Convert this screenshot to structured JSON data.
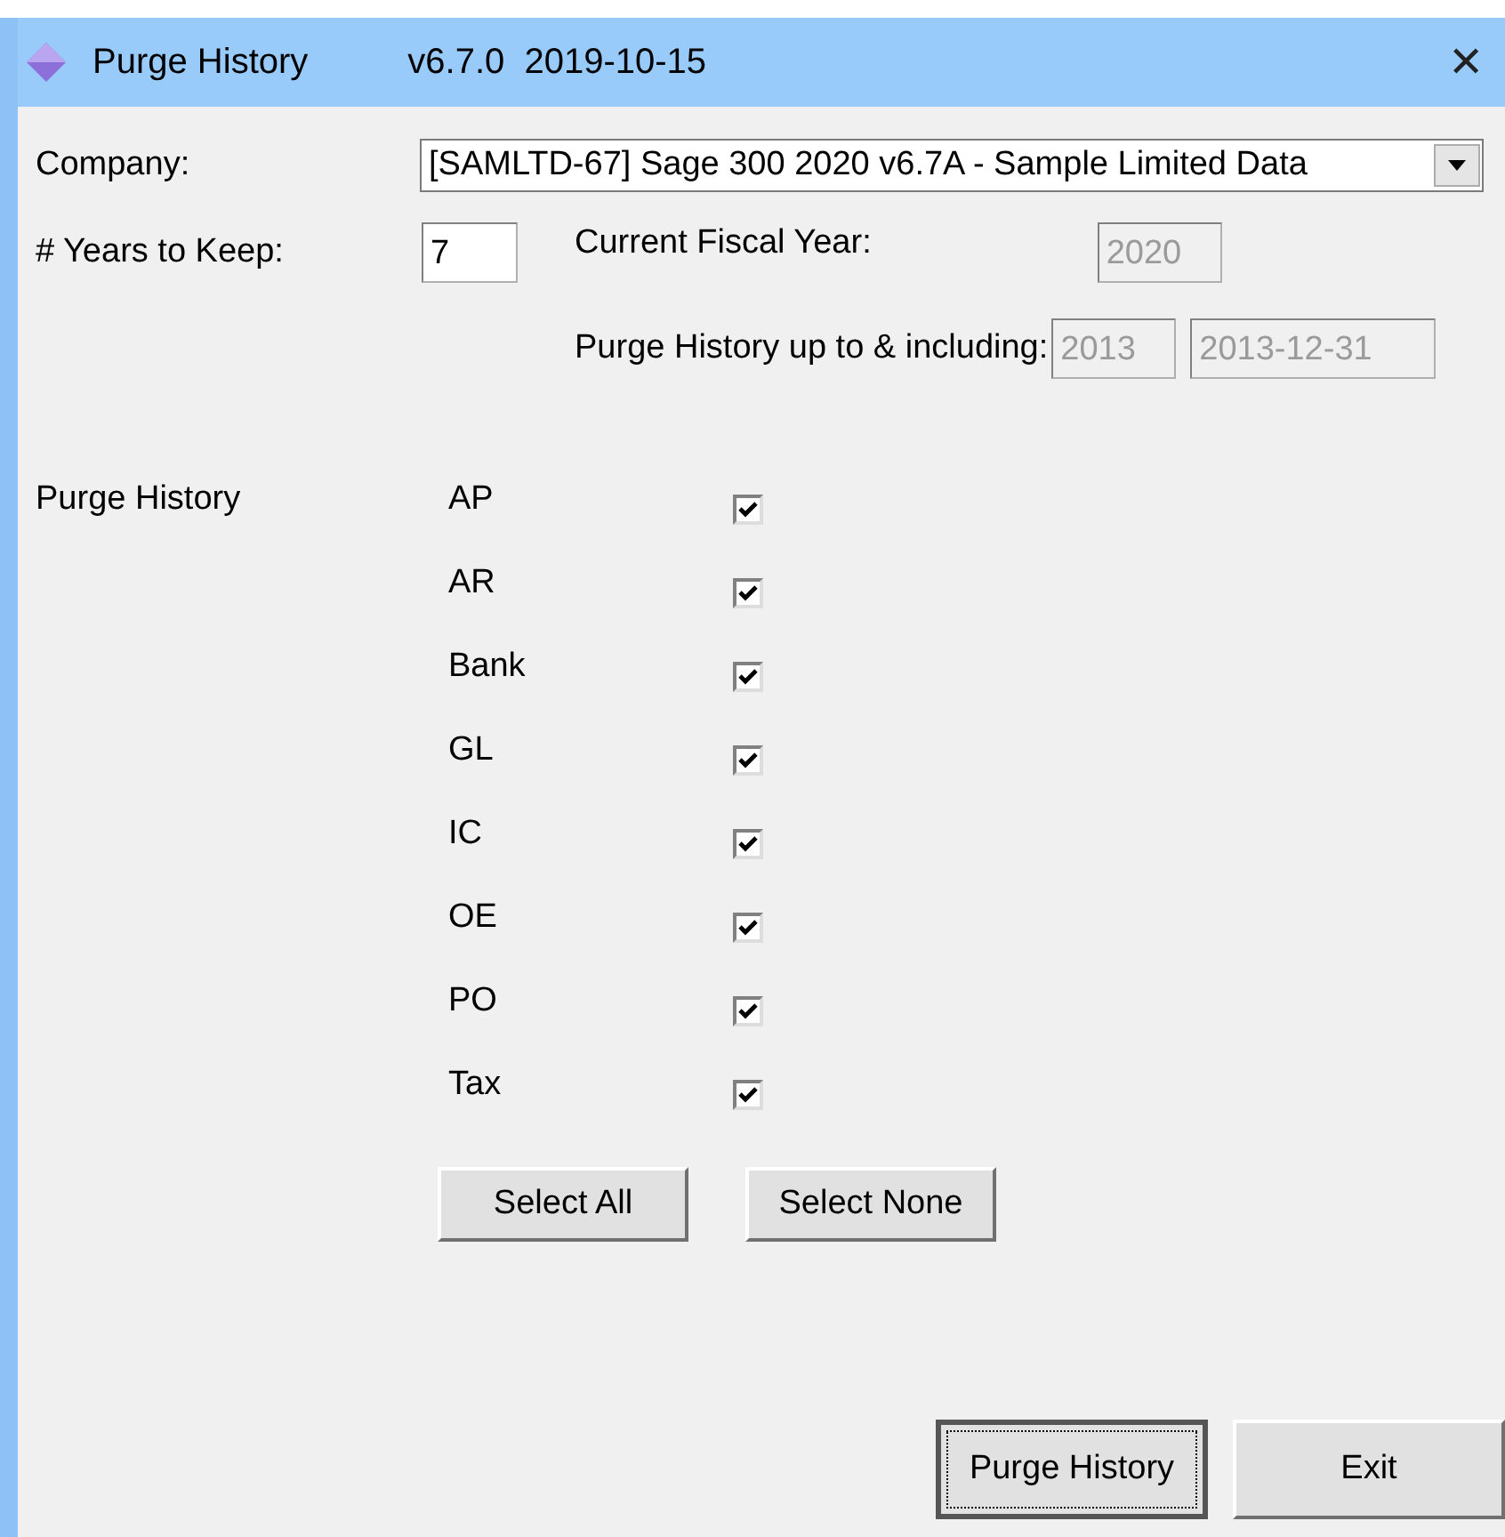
{
  "window": {
    "title": "Purge History",
    "version": "v6.7.0  2019-10-15",
    "close": "✕"
  },
  "company": {
    "label": "Company:",
    "value": "[SAMLTD-67] Sage 300 2020 v6.7A - Sample Limited Data"
  },
  "years_to_keep": {
    "label": "# Years to Keep:",
    "value": "7"
  },
  "current_fiscal_year": {
    "label": "Current Fiscal Year:",
    "value": "2020",
    "disabled": true
  },
  "purge_up_to": {
    "label": "Purge History up to & including:",
    "year": "2013",
    "date": "2013-12-31",
    "disabled": true
  },
  "modules_label": "Purge History",
  "modules": [
    {
      "label": "AP",
      "checked": true
    },
    {
      "label": "AR",
      "checked": true
    },
    {
      "label": "Bank",
      "checked": true
    },
    {
      "label": "GL",
      "checked": true
    },
    {
      "label": "IC",
      "checked": true
    },
    {
      "label": "OE",
      "checked": true
    },
    {
      "label": "PO",
      "checked": true
    },
    {
      "label": "Tax",
      "checked": true
    }
  ],
  "select_buttons": [
    "Select All",
    "Select None"
  ],
  "actions": [
    {
      "label": "Purge History",
      "focused": true
    },
    {
      "label": "Exit",
      "focused": false
    }
  ]
}
